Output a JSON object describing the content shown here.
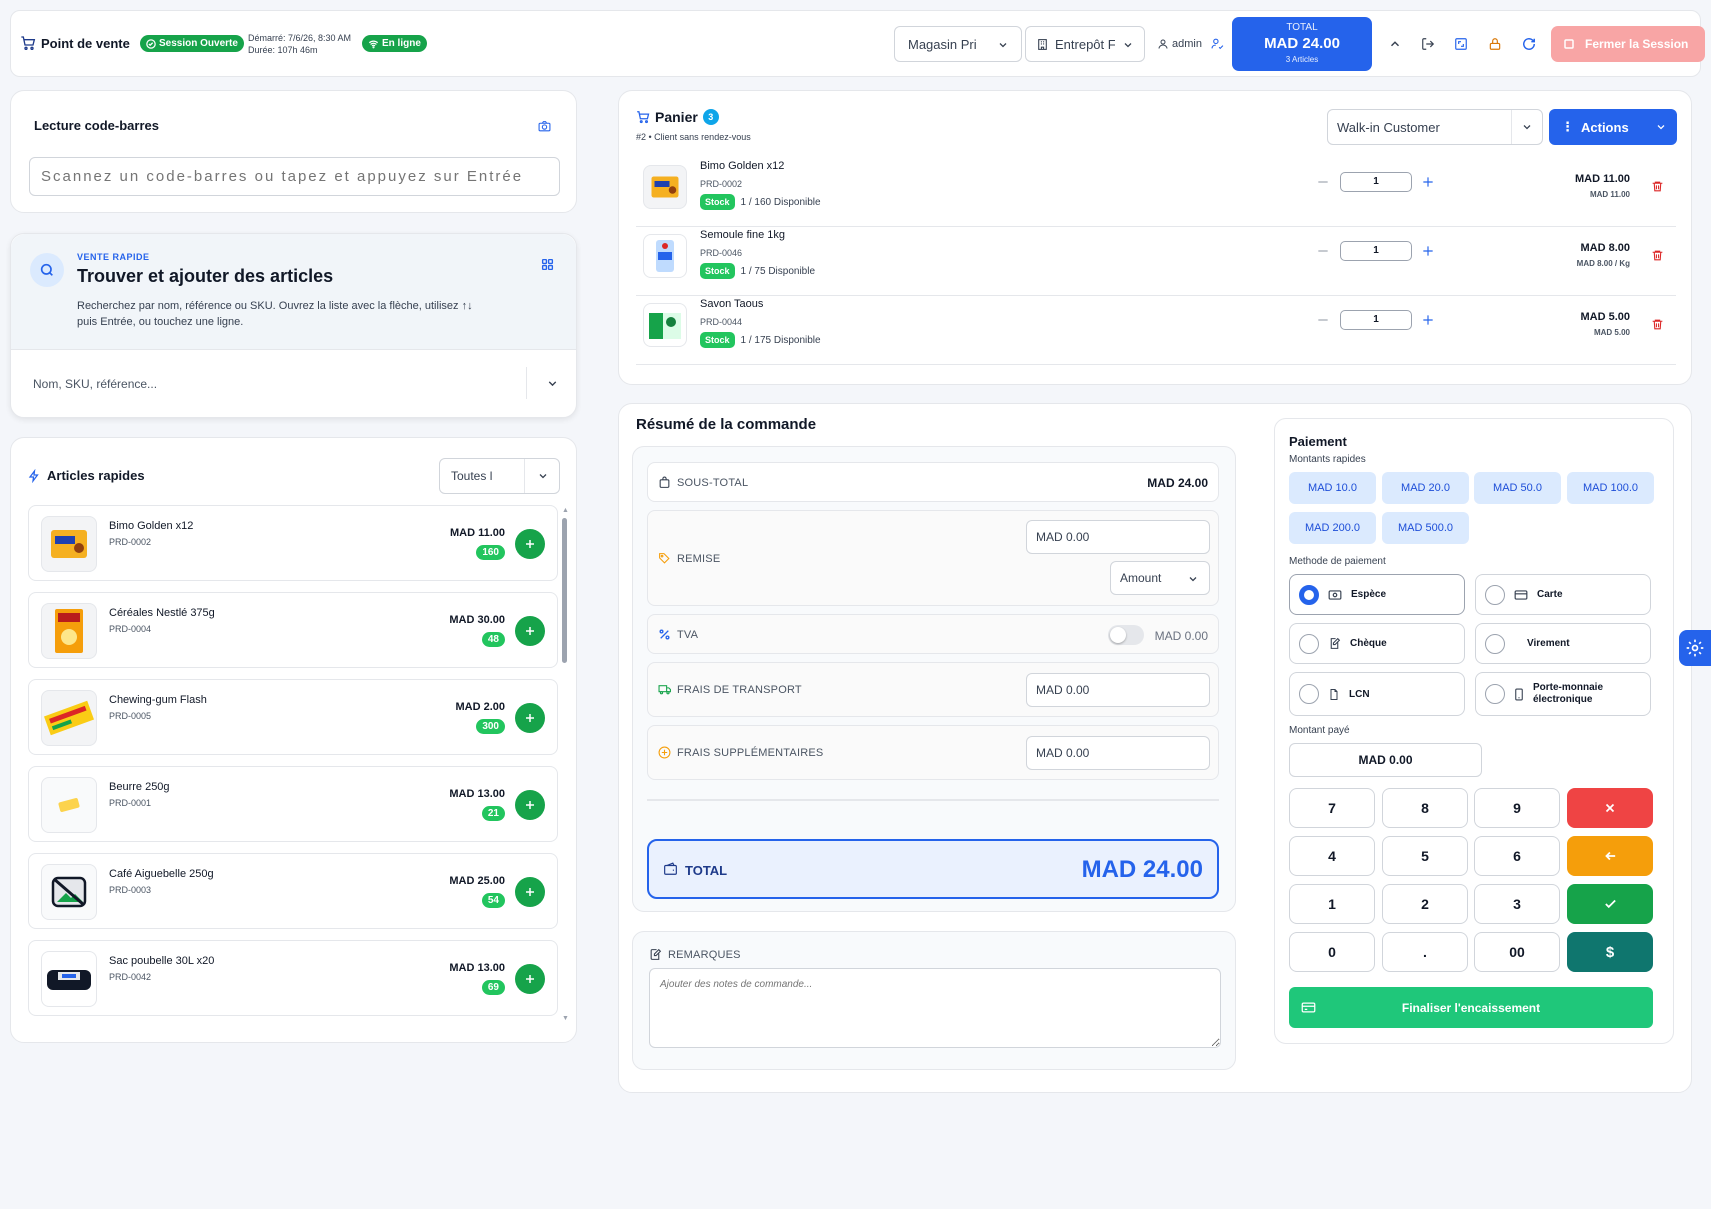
{
  "colors": {
    "primary": "#2563eb",
    "success": "#16a34a",
    "danger": "#dc2626",
    "warning": "#f59e0b",
    "teal": "#0f766e"
  },
  "header": {
    "title": "Point de vente",
    "session_badge": "Session Ouverte",
    "started": "Démarré: 7/6/26, 8:30 AM",
    "duration": "Durée: 107h 46m",
    "online_badge": "En ligne",
    "store_select": "Magasin Pri",
    "warehouse_select": "Entrepôt F",
    "user": "admin",
    "total_label": "TOTAL",
    "total_value": "MAD 24.00",
    "total_articles": "3 Articles",
    "close_session": "Fermer la Session"
  },
  "barcode": {
    "title": "Lecture code-barres",
    "placeholder": "Scannez un code-barres ou tapez et appuyez sur Entrée"
  },
  "quick_sale": {
    "kicker": "VENTE RAPIDE",
    "title": "Trouver et ajouter des articles",
    "desc1": "Recherchez par nom, référence ou SKU. Ouvrez la liste avec la flèche, utilisez ↑↓",
    "desc2": "puis Entrée, ou touchez une ligne.",
    "search_placeholder": "Nom, SKU, référence..."
  },
  "quick_items": {
    "title": "Articles rapides",
    "filter": "Toutes l",
    "items": [
      {
        "name": "Bimo Golden x12",
        "ref": "PRD-0002",
        "price": "MAD 11.00",
        "stock": "160"
      },
      {
        "name": "Céréales Nestlé 375g",
        "ref": "PRD-0004",
        "price": "MAD 30.00",
        "stock": "48"
      },
      {
        "name": "Chewing-gum Flash",
        "ref": "PRD-0005",
        "price": "MAD 2.00",
        "stock": "300"
      },
      {
        "name": "Beurre 250g",
        "ref": "PRD-0001",
        "price": "MAD 13.00",
        "stock": "21"
      },
      {
        "name": "Café Aiguebelle 250g",
        "ref": "PRD-0003",
        "price": "MAD 25.00",
        "stock": "54"
      },
      {
        "name": "Sac poubelle 30L x20",
        "ref": "PRD-0042",
        "price": "MAD 13.00",
        "stock": "69"
      }
    ]
  },
  "cart": {
    "title": "Panier",
    "count": "3",
    "subtitle": "#2 • Client sans rendez-vous",
    "customer": "Walk-in Customer",
    "actions": "Actions",
    "items": [
      {
        "name": "Bimo Golden x12",
        "ref": "PRD-0002",
        "stock_label": "Stock",
        "avail": "1 / 160 Disponible",
        "qty": "1",
        "total": "MAD 11.00",
        "unit": "MAD 11.00"
      },
      {
        "name": "Semoule fine 1kg",
        "ref": "PRD-0046",
        "stock_label": "Stock",
        "avail": "1 / 75 Disponible",
        "qty": "1",
        "total": "MAD 8.00",
        "unit": "MAD 8.00 / Kg"
      },
      {
        "name": "Savon Taous",
        "ref": "PRD-0044",
        "stock_label": "Stock",
        "avail": "1 / 175 Disponible",
        "qty": "1",
        "total": "MAD 5.00",
        "unit": "MAD 5.00"
      }
    ]
  },
  "summary": {
    "title": "Résumé de la commande",
    "subtotal_label": "SOUS-TOTAL",
    "subtotal": "MAD 24.00",
    "discount_label": "REMISE",
    "discount": "MAD 0.00",
    "discount_type": "Amount",
    "tax_label": "TVA",
    "tax": "MAD 0.00",
    "shipping_label": "FRAIS DE TRANSPORT",
    "shipping": "MAD 0.00",
    "extra_label": "FRAIS SUPPLÉMENTAIRES",
    "extra": "MAD 0.00",
    "total_label": "TOTAL",
    "total": "MAD 24.00",
    "notes_label": "REMARQUES",
    "notes_placeholder": "Ajouter des notes de commande..."
  },
  "payment": {
    "title": "Paiement",
    "quick_label": "Montants rapides",
    "quick": [
      "MAD 10.0",
      "MAD 20.0",
      "MAD 50.0",
      "MAD 100.0",
      "MAD 200.0",
      "MAD 500.0"
    ],
    "method_label": "Methode de paiement",
    "methods": [
      {
        "label": "Espèce",
        "icon": "cash-icon",
        "selected": true
      },
      {
        "label": "Carte",
        "icon": "card-icon",
        "selected": false
      },
      {
        "label": "Chèque",
        "icon": "cheque-icon",
        "selected": false
      },
      {
        "label": "Virement",
        "icon": "",
        "selected": false
      },
      {
        "label": "LCN",
        "icon": "document-icon",
        "selected": false
      },
      {
        "label": "Porte-monnaie électronique",
        "icon": "phone-icon",
        "selected": false
      }
    ],
    "paid_label": "Montant payé",
    "paid": "MAD 0.00",
    "keys": [
      "7",
      "8",
      "9",
      "4",
      "5",
      "6",
      "1",
      "2",
      "3",
      "0",
      ".",
      "00"
    ],
    "finalize": "Finaliser l'encaissement"
  }
}
